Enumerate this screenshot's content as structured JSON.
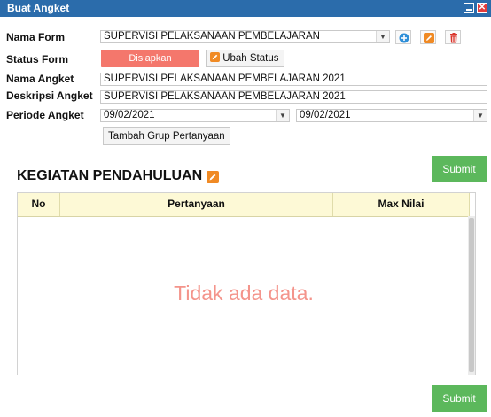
{
  "window": {
    "title": "Buat Angket"
  },
  "form": {
    "nama_form_label": "Nama Form",
    "nama_form_value": "SUPERVISI PELAKSANAAN PEMBELAJARAN",
    "status_form_label": "Status Form",
    "status_value": "Disiapkan",
    "ubah_status_label": "Ubah Status",
    "nama_angket_label": "Nama Angket",
    "nama_angket_value": "SUPERVISI PELAKSANAAN PEMBELAJARAN 2021",
    "deskripsi_label": "Deskripsi Angket",
    "deskripsi_value": "SUPERVISI PELAKSANAAN PEMBELAJARAN 2021",
    "periode_label": "Periode Angket",
    "periode_start": "09/02/2021",
    "periode_end": "09/02/2021",
    "tambah_grup_label": "Tambah Grup Pertanyaan"
  },
  "section": {
    "title": "KEGIATAN PENDAHULUAN",
    "submit_label": "Submit",
    "columns": [
      "No",
      "Pertanyaan",
      "Max Nilai"
    ],
    "empty_message": "Tidak ada data."
  },
  "footer": {
    "submit_label": "Submit"
  },
  "colors": {
    "titlebar": "#2b6cab",
    "status_pill": "#f4776c",
    "submit": "#5cb85c",
    "grid_header": "#fdf9d6",
    "empty_text": "#f4948b"
  },
  "icons": [
    "add-icon",
    "edit-icon",
    "delete-icon",
    "close-icon",
    "minimize-icon",
    "dropdown-arrow-icon"
  ]
}
